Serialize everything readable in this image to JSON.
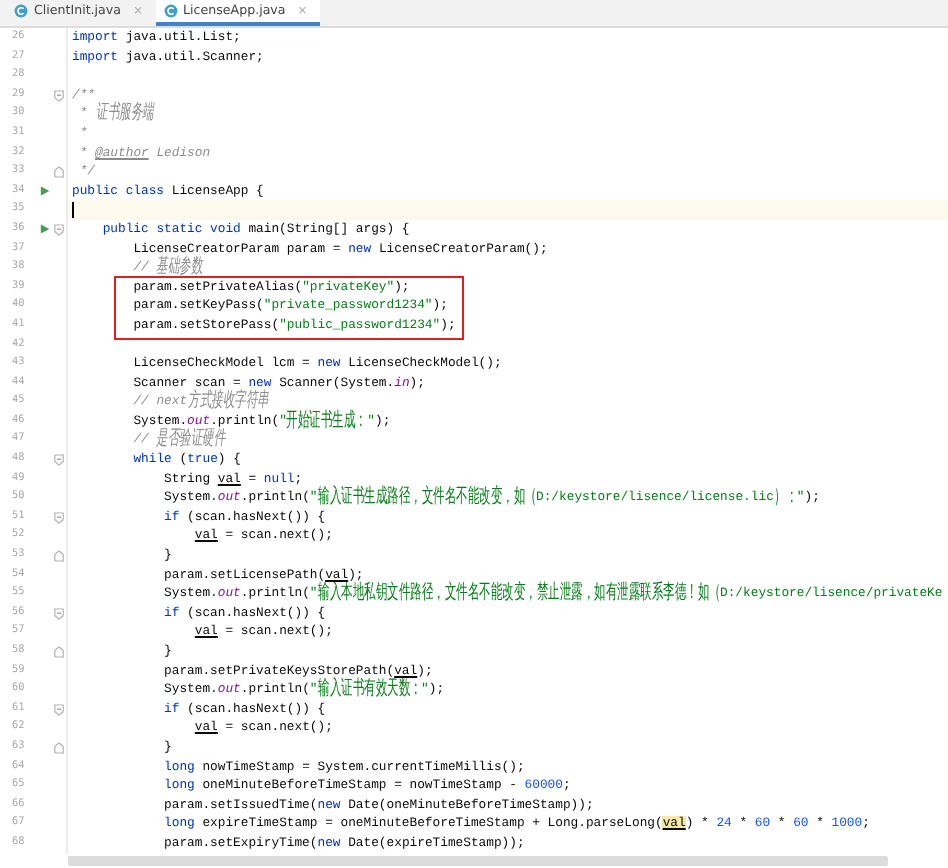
{
  "tabs": [
    {
      "label": "ClientInit.java",
      "close": "×",
      "selected": false
    },
    {
      "label": "LicenseApp.java",
      "close": "×",
      "selected": true
    }
  ],
  "lines": [
    {
      "n": "26",
      "kind": "plain",
      "run": false,
      "current": false,
      "boxed": false,
      "tokens": [
        {
          "kind": "keyword",
          "text": "import"
        },
        {
          "kind": "plain",
          "text": " java.util.List;"
        }
      ]
    },
    {
      "n": "27",
      "kind": "plain",
      "run": false,
      "current": false,
      "boxed": false,
      "tokens": [
        {
          "kind": "keyword",
          "text": "import"
        },
        {
          "kind": "plain",
          "text": " java.util.Scanner;"
        }
      ]
    },
    {
      "n": "28",
      "kind": "plain",
      "run": false,
      "current": false,
      "boxed": false
    },
    {
      "n": "29",
      "kind": "fold_start",
      "run": false,
      "current": false,
      "boxed": false,
      "tokens": [
        {
          "kind": "comment",
          "text": "/**"
        }
      ]
    },
    {
      "n": "30",
      "kind": "plain",
      "run": false,
      "current": false,
      "boxed": false,
      "tokens": [
        {
          "kind": "comment",
          "text": " * 证书服务端"
        }
      ]
    },
    {
      "n": "31",
      "kind": "plain",
      "run": false,
      "current": false,
      "boxed": false,
      "tokens": [
        {
          "kind": "comment",
          "text": " *"
        }
      ]
    },
    {
      "n": "32",
      "kind": "plain",
      "run": false,
      "current": false,
      "boxed": false,
      "tokens": [
        {
          "kind": "comment",
          "text": " * "
        },
        {
          "kind": "doc_tag",
          "text": "@author"
        },
        {
          "kind": "comment",
          "text": " Ledison"
        }
      ]
    },
    {
      "n": "33",
      "kind": "fold_end",
      "run": false,
      "current": false,
      "boxed": false,
      "tokens": [
        {
          "kind": "comment",
          "text": " */"
        }
      ]
    },
    {
      "n": "34",
      "kind": "plain",
      "run": true,
      "current": false,
      "boxed": false,
      "tokens": [
        {
          "kind": "keyword",
          "text": "public class"
        },
        {
          "kind": "plain",
          "text": " LicenseApp {"
        }
      ]
    },
    {
      "n": "35",
      "kind": "plain",
      "run": false,
      "current": true,
      "boxed": false
    },
    {
      "n": "36",
      "kind": "fold_start",
      "run": true,
      "current": false,
      "boxed": false,
      "tokens": [
        {
          "kind": "keyword",
          "text": "    public static void"
        },
        {
          "kind": "plain",
          "text": " main(String[] args) {"
        }
      ]
    },
    {
      "n": "37",
      "kind": "plain",
      "run": false,
      "current": false,
      "boxed": false,
      "tokens": [
        {
          "kind": "plain",
          "text": "        LicenseCreatorParam param = "
        },
        {
          "kind": "keyword",
          "text": "new"
        },
        {
          "kind": "plain",
          "text": " LicenseCreatorParam();"
        }
      ]
    },
    {
      "n": "38",
      "kind": "plain",
      "run": false,
      "current": false,
      "boxed": false,
      "tokens": [
        {
          "kind": "comment",
          "text": "        // 基础参数"
        }
      ]
    },
    {
      "n": "39",
      "kind": "plain",
      "run": false,
      "current": false,
      "boxed": true,
      "tokens": [
        {
          "kind": "plain",
          "text": "        param.setPrivateAlias("
        },
        {
          "kind": "string",
          "text": "\"privateKey\""
        },
        {
          "kind": "plain",
          "text": ");"
        }
      ]
    },
    {
      "n": "40",
      "kind": "plain",
      "run": false,
      "current": false,
      "boxed": true,
      "tokens": [
        {
          "kind": "plain",
          "text": "        param.setKeyPass("
        },
        {
          "kind": "string",
          "text": "\"private_password1234\""
        },
        {
          "kind": "plain",
          "text": ");"
        }
      ]
    },
    {
      "n": "41",
      "kind": "plain",
      "run": false,
      "current": false,
      "boxed": true,
      "tokens": [
        {
          "kind": "plain",
          "text": "        param.setStorePass("
        },
        {
          "kind": "string",
          "text": "\"public_password1234\""
        },
        {
          "kind": "plain",
          "text": ");"
        }
      ]
    },
    {
      "n": "42",
      "kind": "plain",
      "run": false,
      "current": false,
      "boxed": false
    },
    {
      "n": "43",
      "kind": "plain",
      "run": false,
      "current": false,
      "boxed": false,
      "tokens": [
        {
          "kind": "plain",
          "text": "        LicenseCheckModel lcm = "
        },
        {
          "kind": "keyword",
          "text": "new"
        },
        {
          "kind": "plain",
          "text": " LicenseCheckModel();"
        }
      ]
    },
    {
      "n": "44",
      "kind": "plain",
      "run": false,
      "current": false,
      "boxed": false,
      "tokens": [
        {
          "kind": "plain",
          "text": "        Scanner scan = "
        },
        {
          "kind": "keyword",
          "text": "new"
        },
        {
          "kind": "plain",
          "text": " Scanner(System."
        },
        {
          "kind": "field",
          "text": "in"
        },
        {
          "kind": "plain",
          "text": ");"
        }
      ]
    },
    {
      "n": "45",
      "kind": "plain",
      "run": false,
      "current": false,
      "boxed": false,
      "tokens": [
        {
          "kind": "comment",
          "text": "        // next方式接收字符串"
        }
      ]
    },
    {
      "n": "46",
      "kind": "plain",
      "run": false,
      "current": false,
      "boxed": false,
      "tokens": [
        {
          "kind": "plain",
          "text": "        System."
        },
        {
          "kind": "field",
          "text": "out"
        },
        {
          "kind": "plain",
          "text": ".println("
        },
        {
          "kind": "string",
          "text": "\"开始证书生成：\""
        },
        {
          "kind": "plain",
          "text": ");"
        }
      ]
    },
    {
      "n": "47",
      "kind": "plain",
      "run": false,
      "current": false,
      "boxed": false,
      "tokens": [
        {
          "kind": "comment",
          "text": "        // 是否验证硬件"
        }
      ]
    },
    {
      "n": "48",
      "kind": "fold_start",
      "run": false,
      "current": false,
      "boxed": false,
      "tokens": [
        {
          "kind": "keyword",
          "text": "        while"
        },
        {
          "kind": "plain",
          "text": " ("
        },
        {
          "kind": "keyword",
          "text": "true"
        },
        {
          "kind": "plain",
          "text": ") {"
        }
      ]
    },
    {
      "n": "49",
      "kind": "plain",
      "run": false,
      "current": false,
      "boxed": false,
      "tokens": [
        {
          "kind": "plain",
          "text": "            String "
        },
        {
          "kind": "reassigned",
          "text": "val"
        },
        {
          "kind": "plain",
          "text": " = "
        },
        {
          "kind": "keyword",
          "text": "null"
        },
        {
          "kind": "plain",
          "text": ";"
        }
      ]
    },
    {
      "n": "50",
      "kind": "plain",
      "run": false,
      "current": false,
      "boxed": false,
      "tokens": [
        {
          "kind": "plain",
          "text": "            System."
        },
        {
          "kind": "field",
          "text": "out"
        },
        {
          "kind": "plain",
          "text": ".println("
        },
        {
          "kind": "string",
          "text": "\"输入证书生成路径，文件名不能改变，如（D:/keystore/lisence/license.lic）：\""
        },
        {
          "kind": "plain",
          "text": ");"
        }
      ]
    },
    {
      "n": "51",
      "kind": "fold_start",
      "run": false,
      "current": false,
      "boxed": false,
      "tokens": [
        {
          "kind": "keyword",
          "text": "            if"
        },
        {
          "kind": "plain",
          "text": " (scan.hasNext()) {"
        }
      ]
    },
    {
      "n": "52",
      "kind": "plain",
      "run": false,
      "current": false,
      "boxed": false,
      "tokens": [
        {
          "kind": "reassigned",
          "text": "                val"
        },
        {
          "kind": "plain",
          "text": " = scan.next();"
        }
      ]
    },
    {
      "n": "53",
      "kind": "fold_end",
      "run": false,
      "current": false,
      "boxed": false,
      "tokens": [
        {
          "kind": "plain",
          "text": "            }"
        }
      ]
    },
    {
      "n": "54",
      "kind": "plain",
      "run": false,
      "current": false,
      "boxed": false,
      "tokens": [
        {
          "kind": "plain",
          "text": "            param.setLicensePath("
        },
        {
          "kind": "reassigned",
          "text": "val"
        },
        {
          "kind": "plain",
          "text": ");"
        }
      ]
    },
    {
      "n": "55",
      "kind": "plain",
      "run": false,
      "current": false,
      "boxed": false,
      "tokens": [
        {
          "kind": "plain",
          "text": "            System."
        },
        {
          "kind": "field",
          "text": "out"
        },
        {
          "kind": "plain",
          "text": ".println("
        },
        {
          "kind": "string",
          "text": "\"输入本地私钥文件路径，文件名不能改变，禁止泄露，如有泄露联系李德！如（D:/keystore/lisence/privateKe"
        }
      ]
    },
    {
      "n": "56",
      "kind": "fold_start",
      "run": false,
      "current": false,
      "boxed": false,
      "tokens": [
        {
          "kind": "keyword",
          "text": "            if"
        },
        {
          "kind": "plain",
          "text": " (scan.hasNext()) {"
        }
      ]
    },
    {
      "n": "57",
      "kind": "plain",
      "run": false,
      "current": false,
      "boxed": false,
      "tokens": [
        {
          "kind": "reassigned",
          "text": "                val"
        },
        {
          "kind": "plain",
          "text": " = scan.next();"
        }
      ]
    },
    {
      "n": "58",
      "kind": "fold_end",
      "run": false,
      "current": false,
      "boxed": false,
      "tokens": [
        {
          "kind": "plain",
          "text": "            }"
        }
      ]
    },
    {
      "n": "59",
      "kind": "plain",
      "run": false,
      "current": false,
      "boxed": false,
      "tokens": [
        {
          "kind": "plain",
          "text": "            param.setPrivateKeysStorePath("
        },
        {
          "kind": "reassigned",
          "text": "val"
        },
        {
          "kind": "plain",
          "text": ");"
        }
      ]
    },
    {
      "n": "60",
      "kind": "plain",
      "run": false,
      "current": false,
      "boxed": false,
      "tokens": [
        {
          "kind": "plain",
          "text": "            System."
        },
        {
          "kind": "field",
          "text": "out"
        },
        {
          "kind": "plain",
          "text": ".println("
        },
        {
          "kind": "string",
          "text": "\"输入证书有效天数：\""
        },
        {
          "kind": "plain",
          "text": ");"
        }
      ]
    },
    {
      "n": "61",
      "kind": "fold_start",
      "run": false,
      "current": false,
      "boxed": false,
      "tokens": [
        {
          "kind": "keyword",
          "text": "            if"
        },
        {
          "kind": "plain",
          "text": " (scan.hasNext()) {"
        }
      ]
    },
    {
      "n": "62",
      "kind": "plain",
      "run": false,
      "current": false,
      "boxed": false,
      "tokens": [
        {
          "kind": "reassigned",
          "text": "                val"
        },
        {
          "kind": "plain",
          "text": " = scan.next();"
        }
      ]
    },
    {
      "n": "63",
      "kind": "fold_end",
      "run": false,
      "current": false,
      "boxed": false,
      "tokens": [
        {
          "kind": "plain",
          "text": "            }"
        }
      ]
    },
    {
      "n": "64",
      "kind": "plain",
      "run": false,
      "current": false,
      "boxed": false,
      "tokens": [
        {
          "kind": "keyword",
          "text": "            long"
        },
        {
          "kind": "plain",
          "text": " nowTimeStamp = System.currentTimeMillis();"
        }
      ]
    },
    {
      "n": "65",
      "kind": "plain",
      "run": false,
      "current": false,
      "boxed": false,
      "tokens": [
        {
          "kind": "keyword",
          "text": "            long"
        },
        {
          "kind": "plain",
          "text": " oneMinuteBeforeTimeStamp = nowTimeStamp - "
        },
        {
          "kind": "number",
          "text": "60000"
        },
        {
          "kind": "plain",
          "text": ";"
        }
      ]
    },
    {
      "n": "66",
      "kind": "plain",
      "run": false,
      "current": false,
      "boxed": false,
      "tokens": [
        {
          "kind": "plain",
          "text": "            param.setIssuedTime("
        },
        {
          "kind": "keyword",
          "text": "new"
        },
        {
          "kind": "plain",
          "text": " Date(oneMinuteBeforeTimeStamp));"
        }
      ]
    },
    {
      "n": "67",
      "kind": "plain",
      "run": false,
      "current": false,
      "boxed": false,
      "tokens": [
        {
          "kind": "keyword",
          "text": "            long"
        },
        {
          "kind": "plain",
          "text": " expireTimeStamp = oneMinuteBeforeTimeStamp + Long.parseLong("
        },
        {
          "kind": "usage",
          "text": "val"
        },
        {
          "kind": "plain",
          "text": ") * "
        },
        {
          "kind": "number",
          "text": "24"
        },
        {
          "kind": "plain",
          "text": " * "
        },
        {
          "kind": "number",
          "text": "60"
        },
        {
          "kind": "plain",
          "text": " * "
        },
        {
          "kind": "number",
          "text": "60"
        },
        {
          "kind": "plain",
          "text": " * "
        },
        {
          "kind": "number",
          "text": "1000"
        },
        {
          "kind": "plain",
          "text": ";"
        }
      ]
    },
    {
      "n": "68",
      "kind": "plain",
      "run": false,
      "current": false,
      "boxed": false,
      "tokens": [
        {
          "kind": "plain",
          "text": "            param.setExpiryTime("
        },
        {
          "kind": "keyword",
          "text": "new"
        },
        {
          "kind": "plain",
          "text": " Date(expireTimeStamp));"
        }
      ]
    }
  ]
}
